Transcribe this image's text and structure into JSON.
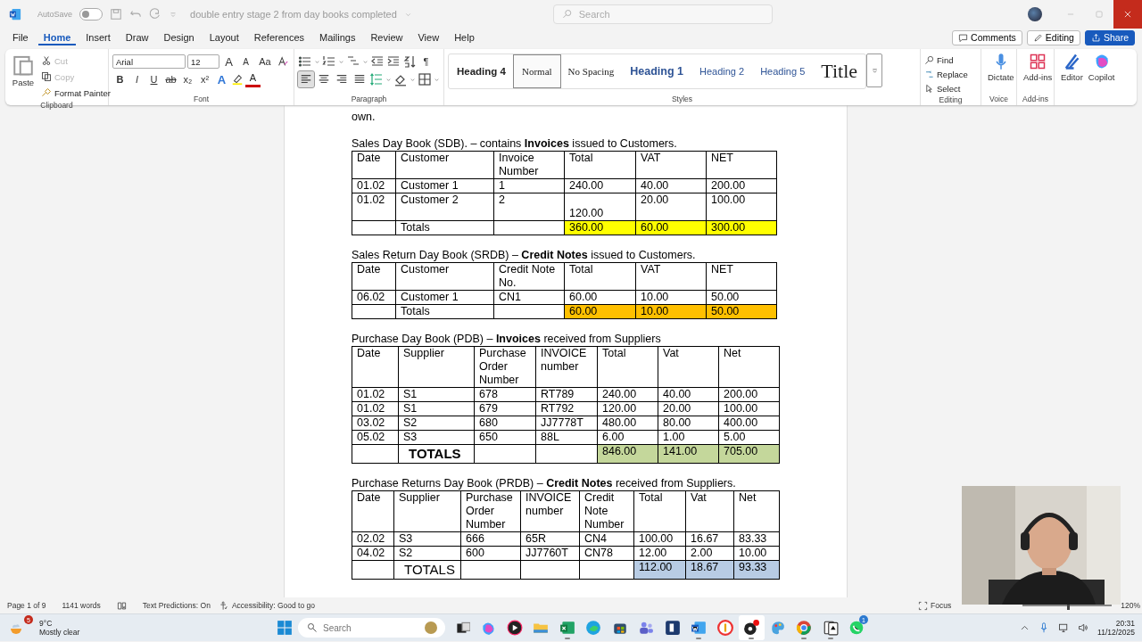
{
  "window": {
    "title": "double entry stage 2 from day books completed",
    "autosave": {
      "label": "AutoSave",
      "on": false
    },
    "search": {
      "placeholder": "Search"
    },
    "close_hovered": true
  },
  "menu_tabs": [
    {
      "label": "File",
      "selected": false
    },
    {
      "label": "Home",
      "selected": true
    },
    {
      "label": "Insert",
      "selected": false
    },
    {
      "label": "Draw",
      "selected": false
    },
    {
      "label": "Design",
      "selected": false
    },
    {
      "label": "Layout",
      "selected": false
    },
    {
      "label": "References",
      "selected": false
    },
    {
      "label": "Mailings",
      "selected": false
    },
    {
      "label": "Review",
      "selected": false
    },
    {
      "label": "View",
      "selected": false
    },
    {
      "label": "Help",
      "selected": false
    }
  ],
  "actions": {
    "comments": "Comments",
    "editing": "Editing",
    "share": "Share"
  },
  "ribbon": {
    "clipboard": {
      "paste": "Paste",
      "items": [
        {
          "label": "Cut",
          "disabled": true
        },
        {
          "label": "Copy",
          "disabled": true
        },
        {
          "label": "Format Painter",
          "disabled": false
        }
      ],
      "group": "Clipboard"
    },
    "font": {
      "family": "Arial",
      "size": "12",
      "tools": [
        {
          "text": "A",
          "kind": "grow"
        },
        {
          "text": "A",
          "kind": "shrink"
        },
        {
          "text": "Aa",
          "kind": "case"
        }
      ],
      "formats": [
        {
          "text": "B",
          "kind": "bold"
        },
        {
          "text": "I",
          "kind": "italic"
        },
        {
          "text": "U",
          "kind": "underline"
        },
        {
          "text": "ab",
          "kind": "strike"
        },
        {
          "text": "x₂",
          "kind": "sub"
        },
        {
          "text": "x²",
          "kind": "sup"
        }
      ],
      "text_effects": "A",
      "font_color": "A",
      "group": "Font"
    },
    "paragraph": {
      "pilcrow": "¶",
      "alignments": [
        {
          "selected": true
        },
        {
          "selected": false
        },
        {
          "selected": false
        },
        {
          "selected": false
        }
      ],
      "group": "Paragraph"
    },
    "styles": {
      "items": [
        {
          "label": "Heading 4",
          "kind": "heading4",
          "selected": false
        },
        {
          "label": "Normal",
          "kind": "normal",
          "selected": true
        },
        {
          "label": "No Spacing",
          "kind": "nospacing",
          "selected": false
        },
        {
          "label": "Heading 1",
          "kind": "heading1",
          "selected": false
        },
        {
          "label": "Heading 2",
          "kind": "heading2",
          "selected": false
        },
        {
          "label": "Heading 5",
          "kind": "heading5",
          "selected": false
        },
        {
          "label": "Title",
          "kind": "title",
          "selected": false
        }
      ],
      "group": "Styles"
    },
    "editing": {
      "items": [
        "Find",
        "Replace",
        "Select"
      ],
      "group": "Editing"
    },
    "voice": {
      "button": "Dictate",
      "group": "Voice"
    },
    "addins": {
      "button": "Add-ins",
      "group": "Add-ins"
    },
    "extra": [
      "Editor",
      "Copilot"
    ]
  },
  "document": {
    "intro": "own.",
    "sections": [
      {
        "heading": "Sales Day Book (SDB). – contains **Invoices** issued to Customers.",
        "color": "#ffff00",
        "columns": [
          "Date",
          "Customer",
          "Invoice Number",
          "Total",
          "VAT",
          "NET"
        ],
        "rows": [
          {
            "cells": [
              "01.02",
              "Customer 1",
              "1",
              "240.00",
              "40.00",
              "200.00"
            ]
          },
          {
            "cells": [
              "01.02",
              "Customer 2",
              "2",
              {
                "text": "120.00",
                "bottom_aligned": true
              },
              "20.00",
              "100.00"
            ]
          },
          {
            "cells": [
              null,
              {
                "text": "Totals",
                "large": false,
                "bold": false
              },
              null,
              {
                "text": "360.00",
                "highlighted": true
              },
              {
                "text": "60.00",
                "highlighted": true
              },
              {
                "text": "300.00",
                "highlighted": true
              }
            ]
          }
        ]
      },
      {
        "heading": "Sales Return Day Book (SRDB) – **Credit Notes** issued to Customers.",
        "color": "#ffc000",
        "columns": [
          "Date",
          "Customer",
          "Credit Note No.",
          "Total",
          "VAT",
          "NET"
        ],
        "rows": [
          {
            "cells": [
              "06.02",
              "Customer 1",
              "CN1",
              "60.00",
              "10.00",
              "50.00"
            ]
          },
          {
            "cells": [
              null,
              {
                "text": "Totals",
                "large": false,
                "bold": false
              },
              null,
              {
                "text": "60.00",
                "highlighted": true
              },
              {
                "text": "10.00",
                "highlighted": true
              },
              {
                "text": "50.00",
                "highlighted": true
              }
            ]
          }
        ]
      },
      {
        "heading": "Purchase Day Book (PDB) – **Invoices** received from Suppliers",
        "color": "#c4d79b",
        "columns": [
          "Date",
          "Supplier",
          "Purchase Order Number",
          "INVOICE number",
          "Total",
          "Vat",
          "Net"
        ],
        "rows": [
          {
            "cells": [
              "01.02",
              "S1",
              "678",
              "RT789",
              "240.00",
              "40.00",
              "200.00"
            ]
          },
          {
            "cells": [
              "01.02",
              "S1",
              "679",
              "RT792",
              "120.00",
              "20.00",
              "100.00"
            ]
          },
          {
            "cells": [
              "03.02",
              "S2",
              "680",
              "JJ7778T",
              "480.00",
              "80.00",
              "400.00"
            ]
          },
          {
            "cells": [
              "05.02",
              "S3",
              "650",
              "88L",
              "6.00",
              "1.00",
              "5.00"
            ]
          },
          {
            "cells": [
              null,
              {
                "text": "TOTALS",
                "large": true,
                "bold": true
              },
              null,
              null,
              {
                "text": "846.00",
                "highlighted": true
              },
              {
                "text": "141.00",
                "highlighted": true
              },
              {
                "text": "705.00",
                "highlighted": true
              }
            ]
          }
        ]
      },
      {
        "heading": "Purchase Returns Day Book (PRDB)  – **Credit Notes** received from Suppliers.",
        "color": "#b8cce4",
        "columns": [
          "Date",
          "Supplier",
          "Purchase Order Number",
          "INVOICE number",
          "Credit Note Number",
          "Total",
          "Vat",
          "Net"
        ],
        "rows": [
          {
            "cells": [
              "02.02",
              "S3",
              "666",
              "65R",
              "CN4",
              "100.00",
              "16.67",
              "83.33"
            ]
          },
          {
            "cells": [
              "04.02",
              "S2",
              "600",
              "JJ7760T",
              "CN78",
              "12.00",
              "2.00",
              "10.00"
            ]
          },
          {
            "cells": [
              null,
              {
                "text": "TOTALS",
                "large": true,
                "bold": false
              },
              null,
              null,
              null,
              {
                "text": "112.00",
                "highlighted": true
              },
              {
                "text": "18.67",
                "highlighted": true
              },
              {
                "text": "93.33",
                "highlighted": true
              }
            ]
          }
        ]
      }
    ]
  },
  "status_bar": {
    "page": "Page 1 of 9",
    "words": "1141 words",
    "predictions": "Text Predictions: On",
    "accessibility": "Accessibility: Good to go",
    "focus": "Focus",
    "zoom": {
      "level": 0.5
    },
    "zoom_label": "120%"
  },
  "taskbar": {
    "weather": {
      "temp": "9°C",
      "summary": "Mostly clear",
      "badge": "5"
    },
    "search": {
      "placeholder": "Search"
    },
    "apps": [
      {
        "kind": "taskview",
        "running": false,
        "active": false
      },
      {
        "kind": "copilot",
        "running": false,
        "active": false
      },
      {
        "kind": "play",
        "running": false,
        "active": false
      },
      {
        "kind": "folder",
        "running": false,
        "active": false
      },
      {
        "kind": "sheet",
        "running": true,
        "active": false
      },
      {
        "kind": "browser",
        "running": false,
        "active": false
      },
      {
        "kind": "store",
        "running": false,
        "active": false
      },
      {
        "kind": "teams",
        "running": false,
        "active": false
      },
      {
        "kind": "bookmark",
        "running": false,
        "active": false
      },
      {
        "kind": "word",
        "running": true,
        "active": false
      },
      {
        "kind": "vpn",
        "running": false,
        "active": false
      },
      {
        "kind": "recorder",
        "running": true,
        "active": true
      },
      {
        "kind": "paint",
        "running": false,
        "active": false
      },
      {
        "kind": "chrome",
        "running": true,
        "active": false
      },
      {
        "kind": "cards",
        "running": true,
        "active": false
      },
      {
        "kind": "chat",
        "running": false,
        "active": false,
        "badge": "1"
      }
    ],
    "clock": {
      "time": "20:31",
      "date": "11/12/2025"
    }
  }
}
